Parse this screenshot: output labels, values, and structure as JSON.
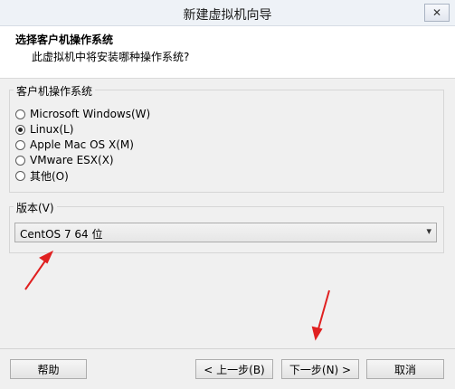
{
  "window": {
    "title": "新建虚拟机向导",
    "close_glyph": "✕"
  },
  "header": {
    "title": "选择客户机操作系统",
    "subtitle": "此虚拟机中将安装哪种操作系统?"
  },
  "guest_os_group": {
    "label": "客户机操作系统",
    "options": [
      {
        "label": "Microsoft Windows(W)",
        "checked": false
      },
      {
        "label": "Linux(L)",
        "checked": true
      },
      {
        "label": "Apple Mac OS X(M)",
        "checked": false
      },
      {
        "label": "VMware ESX(X)",
        "checked": false
      },
      {
        "label": "其他(O)",
        "checked": false
      }
    ]
  },
  "version_group": {
    "label": "版本(V)",
    "selected": "CentOS 7 64 位",
    "dropdown_icon": "chevron-down-icon"
  },
  "buttons": {
    "help": "帮助",
    "back": "< 上一步(B)",
    "next": "下一步(N) >",
    "cancel": "取消"
  },
  "annotation_color": "#e02020"
}
